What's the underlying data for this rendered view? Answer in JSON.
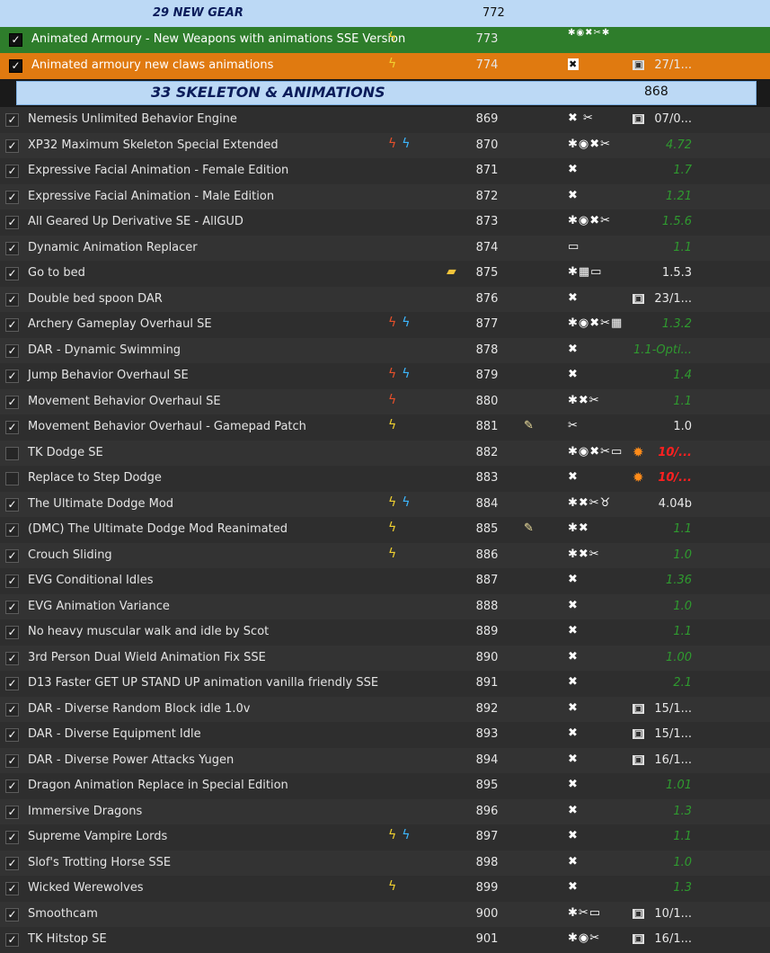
{
  "separators": [
    {
      "title": "29 NEW GEAR",
      "priority": "772"
    },
    {
      "title": "33 SKELETON & ANIMATIONS",
      "priority": "868"
    }
  ],
  "gear_rows": [
    {
      "name": "Animated Armoury - New Weapons with animations SSE Version",
      "priority": "773",
      "content": "✱◉✖✂✱",
      "version": "",
      "endorse": "",
      "flags": "bolt"
    },
    {
      "name": "Animated armoury new claws animations",
      "priority": "774",
      "content": "✖",
      "version": "27/1...",
      "endorse": "calendar",
      "flags": "bolt"
    }
  ],
  "rows": [
    {
      "name": "Nemesis Unlimited Behavior Engine",
      "checked": true,
      "flags": "",
      "priority": "869",
      "note": "",
      "content": "✖ ✂",
      "endorse": "calendar",
      "version": "07/0...",
      "vstyle": "date"
    },
    {
      "name": "XP32 Maximum Skeleton Special Extended",
      "checked": true,
      "flags": "red-blue",
      "priority": "870",
      "note": "",
      "content": "✱◉✖✂",
      "endorse": "",
      "version": "4.72",
      "vstyle": "green"
    },
    {
      "name": "Expressive Facial Animation - Female Edition",
      "checked": true,
      "flags": "",
      "priority": "871",
      "note": "",
      "content": "✖",
      "endorse": "",
      "version": "1.7",
      "vstyle": "green"
    },
    {
      "name": "Expressive Facial Animation - Male Edition",
      "checked": true,
      "flags": "",
      "priority": "872",
      "note": "",
      "content": "✖",
      "endorse": "",
      "version": "1.21",
      "vstyle": "green"
    },
    {
      "name": "All Geared Up Derivative SE - AllGUD",
      "checked": true,
      "flags": "",
      "priority": "873",
      "note": "",
      "content": "✱◉✖✂",
      "endorse": "",
      "version": "1.5.6",
      "vstyle": "green"
    },
    {
      "name": "Dynamic Animation Replacer",
      "checked": true,
      "flags": "",
      "priority": "874",
      "note": "",
      "content": "▭",
      "endorse": "",
      "version": "1.1",
      "vstyle": "green"
    },
    {
      "name": "Go to bed",
      "checked": true,
      "flags": "folder",
      "priority": "875",
      "note": "",
      "content": "✱▦▭",
      "endorse": "",
      "version": "1.5.3",
      "vstyle": "white"
    },
    {
      "name": "Double bed spoon DAR",
      "checked": true,
      "flags": "",
      "priority": "876",
      "note": "",
      "content": "✖",
      "endorse": "calendar",
      "version": "23/1...",
      "vstyle": "date"
    },
    {
      "name": "Archery Gameplay Overhaul SE",
      "checked": true,
      "flags": "red-blue",
      "priority": "877",
      "note": "",
      "content": "✱◉✖✂▦",
      "endorse": "",
      "version": "1.3.2",
      "vstyle": "green"
    },
    {
      "name": "DAR - Dynamic Swimming",
      "checked": true,
      "flags": "",
      "priority": "878",
      "note": "",
      "content": "✖",
      "endorse": "",
      "version": "1.1-Opti...",
      "vstyle": "green"
    },
    {
      "name": "Jump Behavior Overhaul SE",
      "checked": true,
      "flags": "red-blue",
      "priority": "879",
      "note": "",
      "content": "✖",
      "endorse": "",
      "version": "1.4",
      "vstyle": "green"
    },
    {
      "name": "Movement Behavior Overhaul SE",
      "checked": true,
      "flags": "red",
      "priority": "880",
      "note": "",
      "content": "✱✖✂",
      "endorse": "",
      "version": "1.1",
      "vstyle": "green"
    },
    {
      "name": "Movement Behavior Overhaul - Gamepad Patch",
      "checked": true,
      "flags": "bolt",
      "priority": "881",
      "note": "✎",
      "content": "✂",
      "endorse": "",
      "version": "1.0",
      "vstyle": "white"
    },
    {
      "name": "TK Dodge SE",
      "checked": false,
      "flags": "",
      "priority": "882",
      "note": "",
      "content": "✱◉✖✂▭",
      "endorse": "star",
      "version": "10/...",
      "vstyle": "red"
    },
    {
      "name": "Replace to Step Dodge",
      "checked": false,
      "flags": "",
      "priority": "883",
      "note": "",
      "content": "✖",
      "endorse": "star",
      "version": "10/...",
      "vstyle": "red"
    },
    {
      "name": "The Ultimate Dodge Mod",
      "checked": true,
      "flags": "bolt-blue",
      "priority": "884",
      "note": "",
      "content": "✱✖✂♉",
      "endorse": "",
      "version": "4.04b",
      "vstyle": "white"
    },
    {
      "name": "(DMC) The Ultimate Dodge Mod Reanimated",
      "checked": true,
      "flags": "bolt",
      "priority": "885",
      "note": "✎",
      "content": "✱✖",
      "endorse": "",
      "version": "1.1",
      "vstyle": "green"
    },
    {
      "name": "Crouch Sliding",
      "checked": true,
      "flags": "bolt",
      "priority": "886",
      "note": "",
      "content": "✱✖✂",
      "endorse": "",
      "version": "1.0",
      "vstyle": "green"
    },
    {
      "name": "EVG Conditional Idles",
      "checked": true,
      "flags": "",
      "priority": "887",
      "note": "",
      "content": "✖",
      "endorse": "",
      "version": "1.36",
      "vstyle": "green"
    },
    {
      "name": "EVG Animation Variance",
      "checked": true,
      "flags": "",
      "priority": "888",
      "note": "",
      "content": "✖",
      "endorse": "",
      "version": "1.0",
      "vstyle": "green"
    },
    {
      "name": "No heavy muscular walk and idle by Scot",
      "checked": true,
      "flags": "",
      "priority": "889",
      "note": "",
      "content": "✖",
      "endorse": "",
      "version": "1.1",
      "vstyle": "green"
    },
    {
      "name": "3rd Person Dual Wield Animation Fix SSE",
      "checked": true,
      "flags": "",
      "priority": "890",
      "note": "",
      "content": "✖",
      "endorse": "",
      "version": "1.00",
      "vstyle": "green"
    },
    {
      "name": "D13 Faster GET UP STAND UP animation vanilla friendly SSE",
      "checked": true,
      "flags": "",
      "priority": "891",
      "note": "",
      "content": "✖",
      "endorse": "",
      "version": "2.1",
      "vstyle": "green"
    },
    {
      "name": "DAR - Diverse Random Block idle 1.0v",
      "checked": true,
      "flags": "",
      "priority": "892",
      "note": "",
      "content": "✖",
      "endorse": "calendar",
      "version": "15/1...",
      "vstyle": "date"
    },
    {
      "name": "DAR - Diverse Equipment Idle",
      "checked": true,
      "flags": "",
      "priority": "893",
      "note": "",
      "content": "✖",
      "endorse": "calendar",
      "version": "15/1...",
      "vstyle": "date"
    },
    {
      "name": "DAR - Diverse Power Attacks Yugen",
      "checked": true,
      "flags": "",
      "priority": "894",
      "note": "",
      "content": "✖",
      "endorse": "calendar",
      "version": "16/1...",
      "vstyle": "date"
    },
    {
      "name": "Dragon Animation Replace in Special Edition",
      "checked": true,
      "flags": "",
      "priority": "895",
      "note": "",
      "content": "✖",
      "endorse": "",
      "version": "1.01",
      "vstyle": "green"
    },
    {
      "name": "Immersive Dragons",
      "checked": true,
      "flags": "",
      "priority": "896",
      "note": "",
      "content": "✖",
      "endorse": "",
      "version": "1.3",
      "vstyle": "green"
    },
    {
      "name": "Supreme Vampire Lords",
      "checked": true,
      "flags": "bolt-blue",
      "priority": "897",
      "note": "",
      "content": "✖",
      "endorse": "",
      "version": "1.1",
      "vstyle": "green"
    },
    {
      "name": "Slof's Trotting Horse SSE",
      "checked": true,
      "flags": "",
      "priority": "898",
      "note": "",
      "content": "✖",
      "endorse": "",
      "version": "1.0",
      "vstyle": "green"
    },
    {
      "name": "Wicked Werewolves",
      "checked": true,
      "flags": "bolt",
      "priority": "899",
      "note": "",
      "content": "✖",
      "endorse": "",
      "version": "1.3",
      "vstyle": "green"
    },
    {
      "name": "Smoothcam",
      "checked": true,
      "flags": "",
      "priority": "900",
      "note": "",
      "content": "✱✂▭",
      "endorse": "calendar",
      "version": "10/1...",
      "vstyle": "date"
    },
    {
      "name": "TK Hitstop SE",
      "checked": true,
      "flags": "",
      "priority": "901",
      "note": "",
      "content": "✱◉✂",
      "endorse": "calendar",
      "version": "16/1...",
      "vstyle": "date"
    }
  ],
  "glyphs": {
    "check": "✓",
    "bolt": "ϟ",
    "folder": "▰",
    "calendar": "▣",
    "star": "✹"
  },
  "colors": {
    "row_green": "#2e7d2b",
    "row_orange": "#e07a10",
    "separator_bg": "#bcd9f5",
    "separator_text": "#0b1c5a",
    "version_green": "#2f9a2f",
    "version_red": "#ff2020"
  }
}
